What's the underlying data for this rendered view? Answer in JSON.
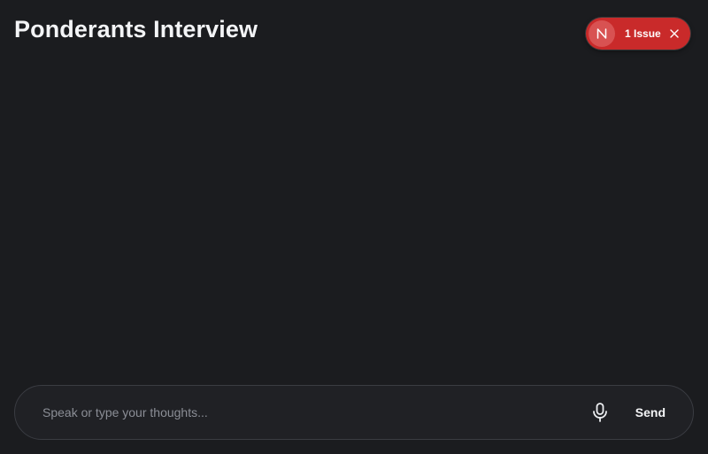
{
  "header": {
    "title": "Ponderants Interview"
  },
  "issues_badge": {
    "logo_letter": "N",
    "label": "1 Issue",
    "color": "#c92a2a"
  },
  "composer": {
    "placeholder": "Speak or type your thoughts...",
    "value": "",
    "send_label": "Send",
    "mic_icon": "microphone-icon"
  },
  "colors": {
    "background": "#1b1c1f",
    "input_background": "#202125",
    "input_border": "#3a3c42"
  }
}
